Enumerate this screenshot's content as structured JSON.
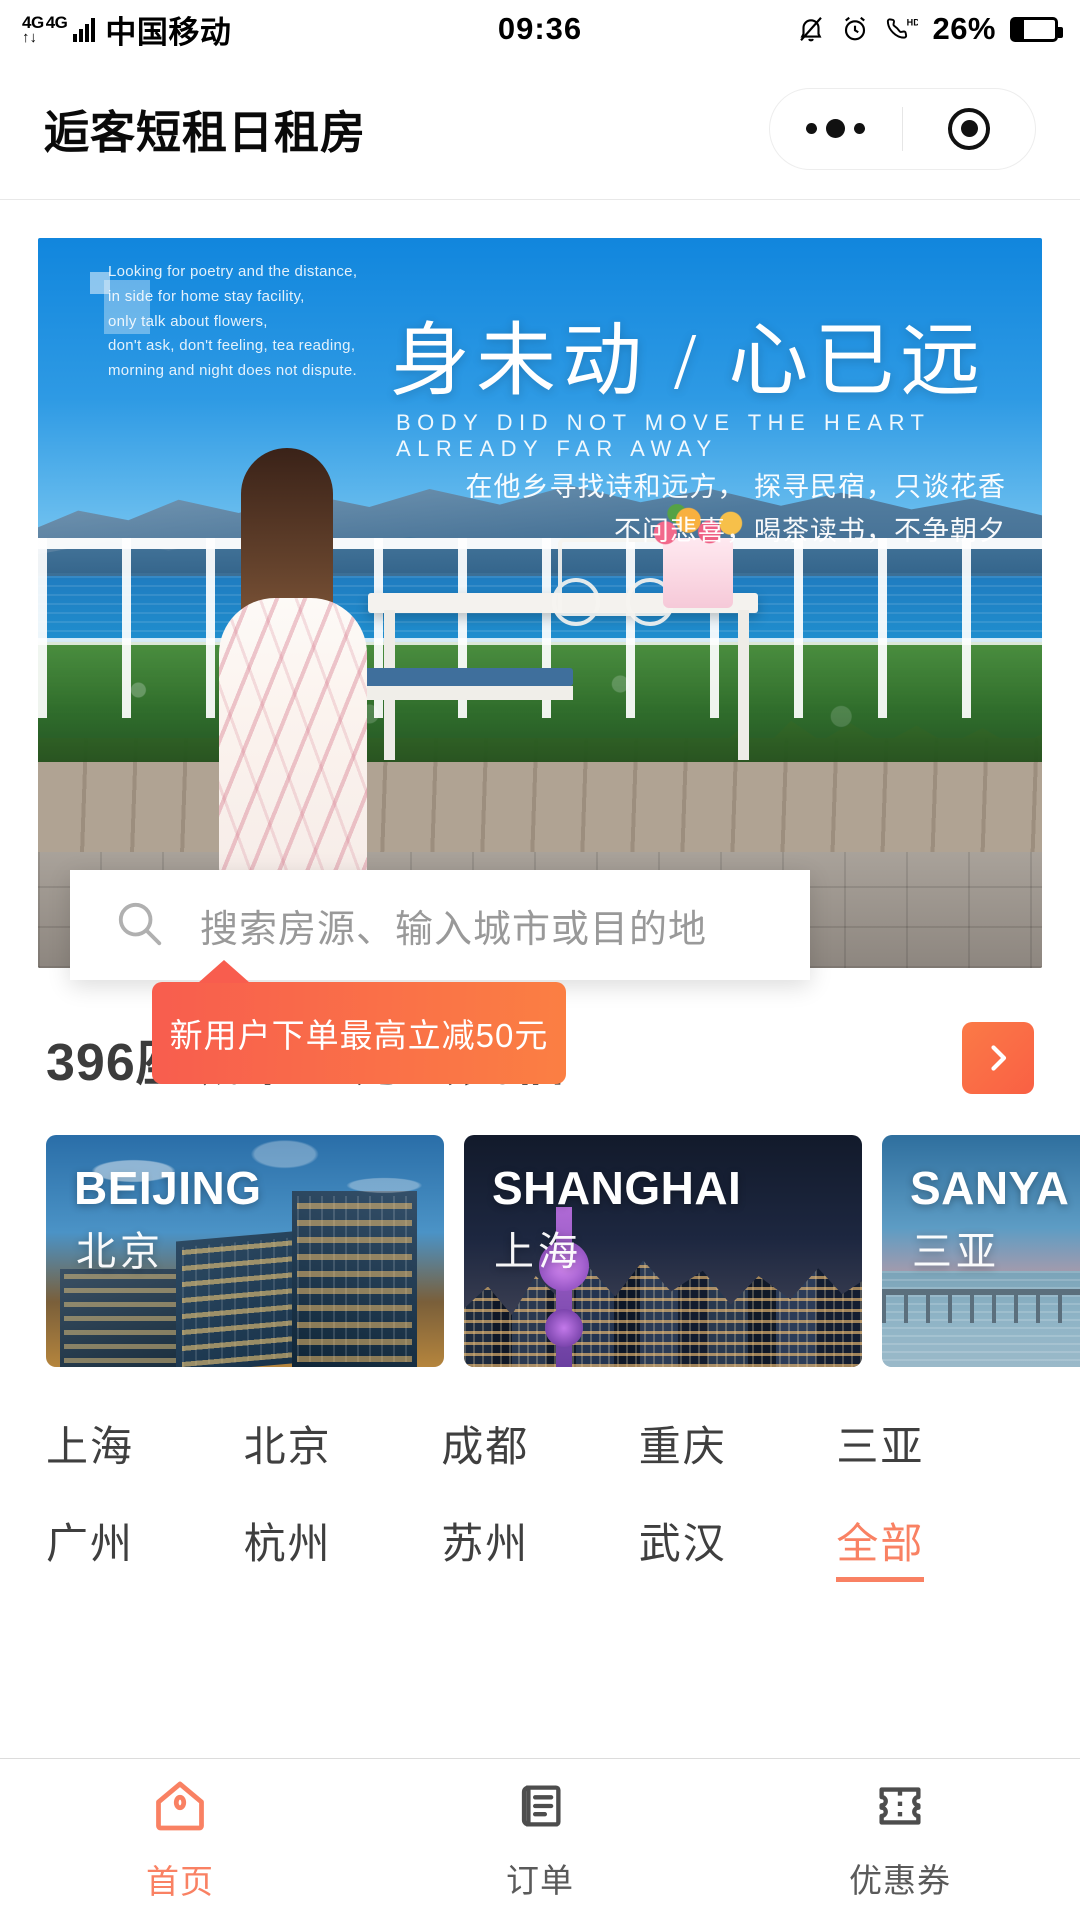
{
  "status_bar": {
    "network_label": "4G",
    "network_label_2": "4G",
    "carrier": "中国移动",
    "time": "09:36",
    "battery_percent": "26%",
    "icons": [
      "mute-bell-icon",
      "alarm-clock-icon",
      "hd-call-icon",
      "battery-icon"
    ]
  },
  "header": {
    "title": "逅客短租日租房",
    "capsule": {
      "menu_icon": "more-dots-icon",
      "close_icon": "target-circle-icon"
    }
  },
  "banner": {
    "english_block": "Looking for poetry and the distance,\nin side for home stay facility,\nonly talk about flowers,\ndon't ask, don't feeling, tea reading,\nmorning and night does not dispute.",
    "title": "身未动 / 心已远",
    "subtitle": "BODY DID NOT MOVE THE HEART ALREADY FAR AWAY",
    "poem_line1": "在他乡寻找诗和远方，  探寻民宿，只谈花香",
    "poem_line2": "不问悲喜，喝茶读书，不争朝夕"
  },
  "search": {
    "icon": "search-icon",
    "placeholder": "搜索房源、输入城市或目的地",
    "value": ""
  },
  "promo": {
    "text": "新用户下单最高立减50元"
  },
  "cities_section": {
    "title": "396座城市50万套民宿",
    "more_icon": "chevron-right-icon",
    "cards": [
      {
        "en": "BEIJING",
        "cn": "北京"
      },
      {
        "en": "SHANGHAI",
        "cn": "上海"
      },
      {
        "en": "SANYA",
        "cn": "三亚"
      }
    ],
    "grid": [
      {
        "label": "上海",
        "accent": false
      },
      {
        "label": "北京",
        "accent": false
      },
      {
        "label": "成都",
        "accent": false
      },
      {
        "label": "重庆",
        "accent": false
      },
      {
        "label": "三亚",
        "accent": false
      },
      {
        "label": "广州",
        "accent": false
      },
      {
        "label": "杭州",
        "accent": false
      },
      {
        "label": "苏州",
        "accent": false
      },
      {
        "label": "武汉",
        "accent": false
      },
      {
        "label": "全部",
        "accent": true
      }
    ]
  },
  "tabbar": {
    "items": [
      {
        "label": "首页",
        "icon": "home-icon",
        "active": true
      },
      {
        "label": "订单",
        "icon": "order-list-icon",
        "active": false
      },
      {
        "label": "优惠券",
        "icon": "coupon-ticket-icon",
        "active": false
      }
    ]
  },
  "colors": {
    "accent": "#f98163",
    "promo_start": "#f85d4e",
    "promo_end": "#fb7f43",
    "text_dark": "#3c3c3c"
  }
}
